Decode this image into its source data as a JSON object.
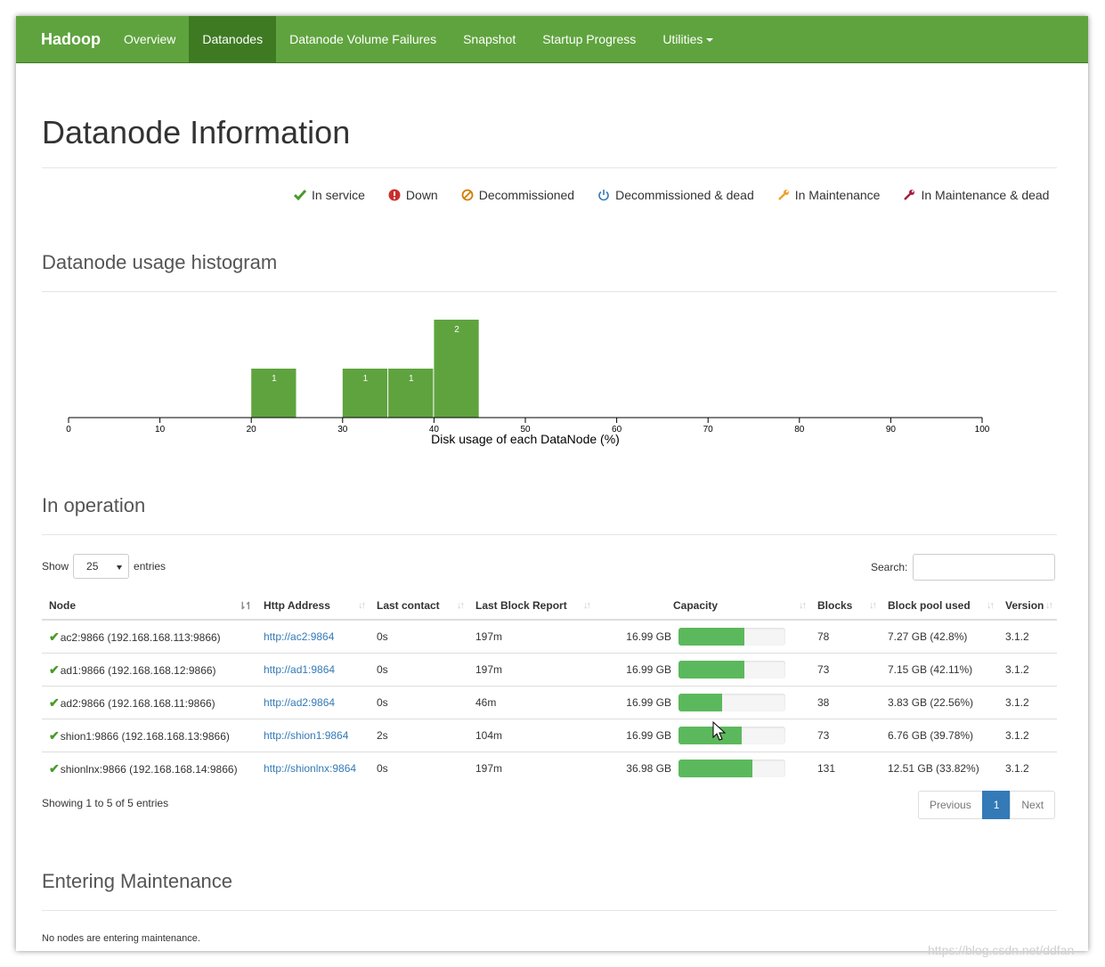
{
  "navbar": {
    "brand": "Hadoop",
    "items": [
      {
        "label": "Overview"
      },
      {
        "label": "Datanodes"
      },
      {
        "label": "Datanode Volume Failures"
      },
      {
        "label": "Snapshot"
      },
      {
        "label": "Startup Progress"
      },
      {
        "label": "Utilities"
      }
    ]
  },
  "page_title": "Datanode Information",
  "legend": [
    {
      "label": "In service",
      "icon": "check-icon",
      "color": "#4a9a2a"
    },
    {
      "label": "Down",
      "icon": "exclamation-circle-icon",
      "color": "#c9302c"
    },
    {
      "label": "Decommissioned",
      "icon": "ban-icon",
      "color": "#d27b00"
    },
    {
      "label": "Decommissioned & dead",
      "icon": "power-icon",
      "color": "#337ab7"
    },
    {
      "label": "In Maintenance",
      "icon": "wrench-icon",
      "color": "#f0a030"
    },
    {
      "label": "In Maintenance & dead",
      "icon": "wrench-icon",
      "color": "#a3203a"
    }
  ],
  "histogram_title": "Datanode usage histogram",
  "chart_data": {
    "type": "bar",
    "xlabel": "Disk usage of each DataNode (%)",
    "xlim": [
      0,
      100
    ],
    "ticks": [
      "0",
      "10",
      "20",
      "30",
      "40",
      "50",
      "60",
      "70",
      "80",
      "90",
      "100"
    ],
    "bins": [
      {
        "x0": 20,
        "x1": 25,
        "count": 1
      },
      {
        "x0": 30,
        "x1": 35,
        "count": 1
      },
      {
        "x0": 35,
        "x1": 40,
        "count": 1
      },
      {
        "x0": 40,
        "x1": 45,
        "count": 2
      }
    ],
    "bar_color": "#5fa33e"
  },
  "in_operation": {
    "title": "In operation",
    "show_label": "Show",
    "entries_select": "25",
    "entries_label": "entries",
    "search_label": "Search:",
    "columns": [
      "Node",
      "Http Address",
      "Last contact",
      "Last Block Report",
      "Capacity",
      "Blocks",
      "Block pool used",
      "Version"
    ],
    "rows": [
      {
        "node": "ac2:9866 (192.168.168.113:9866)",
        "http": "http://ac2:9864",
        "last_contact": "0s",
        "last_block_report": "197m",
        "capacity": "16.99 GB",
        "usage": 0.62,
        "blocks": "78",
        "block_pool_used": "7.27 GB (42.8%)",
        "version": "3.1.2"
      },
      {
        "node": "ad1:9866 (192.168.168.12:9866)",
        "http": "http://ad1:9864",
        "last_contact": "0s",
        "last_block_report": "197m",
        "capacity": "16.99 GB",
        "usage": 0.62,
        "blocks": "73",
        "block_pool_used": "7.15 GB (42.11%)",
        "version": "3.1.2"
      },
      {
        "node": "ad2:9866 (192.168.168.11:9866)",
        "http": "http://ad2:9864",
        "last_contact": "0s",
        "last_block_report": "46m",
        "capacity": "16.99 GB",
        "usage": 0.41,
        "blocks": "38",
        "block_pool_used": "3.83 GB (22.56%)",
        "version": "3.1.2"
      },
      {
        "node": "shion1:9866 (192.168.168.13:9866)",
        "http": "http://shion1:9864",
        "last_contact": "2s",
        "last_block_report": "104m",
        "capacity": "16.99 GB",
        "usage": 0.59,
        "blocks": "73",
        "block_pool_used": "6.76 GB (39.78%)",
        "version": "3.1.2"
      },
      {
        "node": "shionlnx:9866 (192.168.168.14:9866)",
        "http": "http://shionlnx:9864",
        "last_contact": "0s",
        "last_block_report": "197m",
        "capacity": "36.98 GB",
        "usage": 0.69,
        "blocks": "131",
        "block_pool_used": "12.51 GB (33.82%)",
        "version": "3.1.2"
      }
    ],
    "info": "Showing 1 to 5 of 5 entries",
    "pager": {
      "previous": "Previous",
      "current": "1",
      "next": "Next"
    }
  },
  "entering_maintenance": {
    "title": "Entering Maintenance",
    "message": "No nodes are entering maintenance."
  },
  "watermark": "https://blog.csdn.net/ddfan"
}
